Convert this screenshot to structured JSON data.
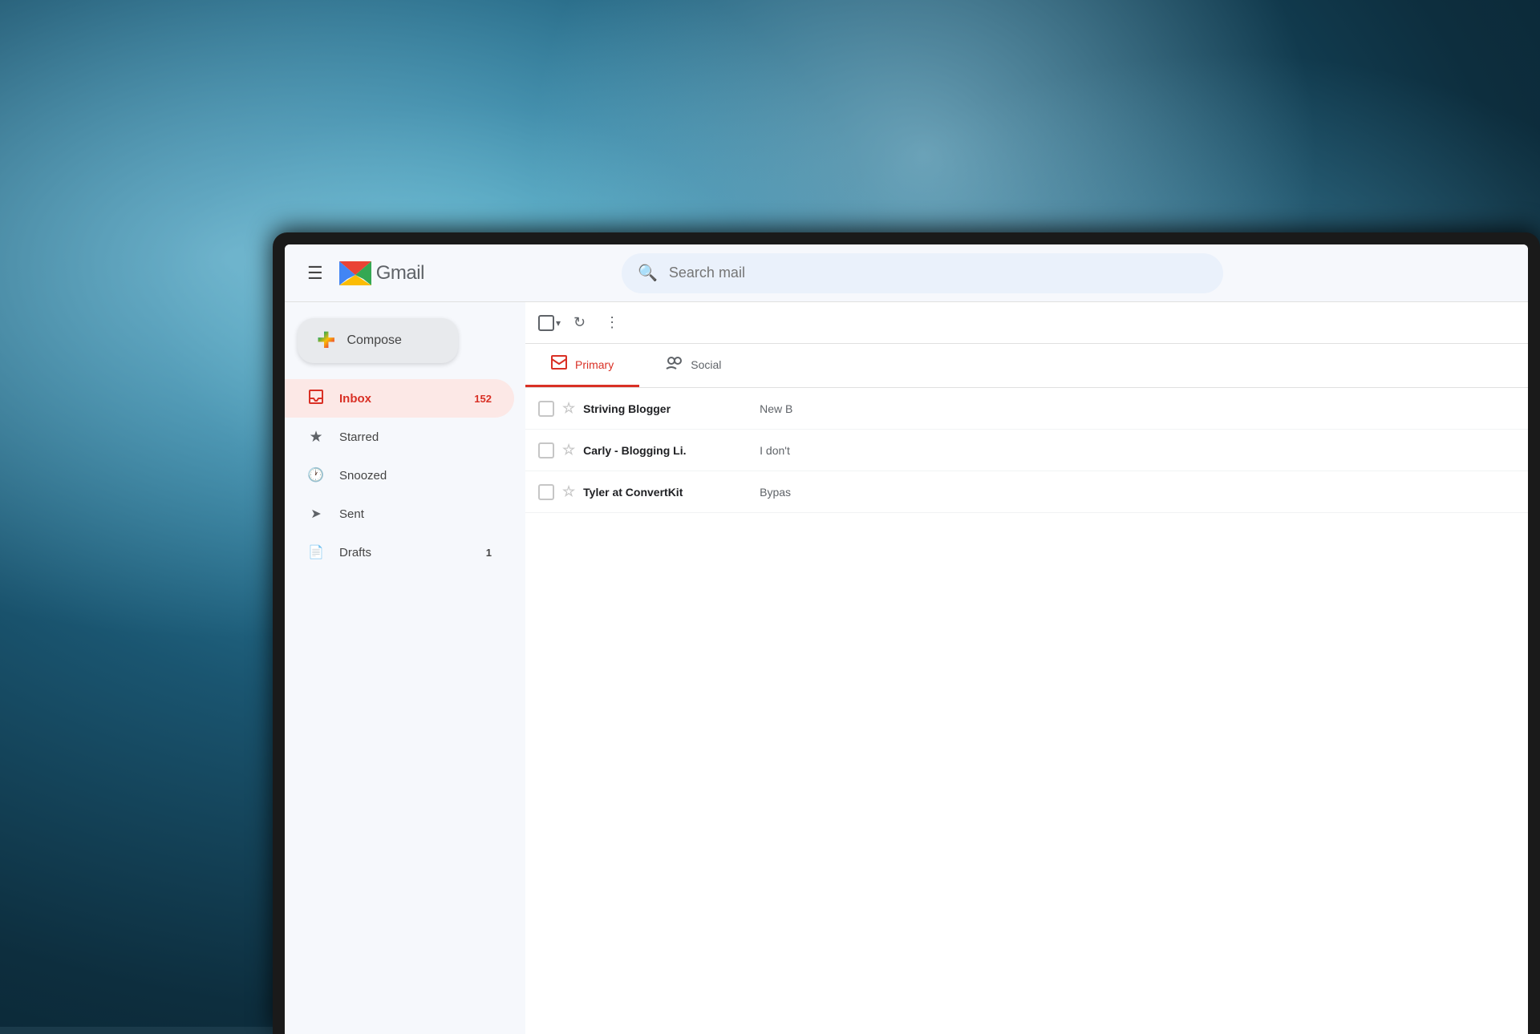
{
  "background": {
    "description": "Blurred teal and blue bokeh background"
  },
  "header": {
    "hamburger_label": "☰",
    "logo_text": "Gmail",
    "search_placeholder": "Search mail"
  },
  "sidebar": {
    "compose_label": "Compose",
    "items": [
      {
        "id": "inbox",
        "label": "Inbox",
        "badge": "152",
        "active": true,
        "icon": "inbox"
      },
      {
        "id": "starred",
        "label": "Starred",
        "badge": "",
        "active": false,
        "icon": "star"
      },
      {
        "id": "snoozed",
        "label": "Snoozed",
        "badge": "",
        "active": false,
        "icon": "clock"
      },
      {
        "id": "sent",
        "label": "Sent",
        "badge": "",
        "active": false,
        "icon": "send"
      },
      {
        "id": "drafts",
        "label": "Drafts",
        "badge": "1",
        "active": false,
        "icon": "draft"
      }
    ]
  },
  "toolbar": {
    "refresh_title": "Refresh",
    "more_title": "More"
  },
  "tabs": [
    {
      "id": "primary",
      "label": "Primary",
      "active": true,
      "icon": "💬"
    },
    {
      "id": "social",
      "label": "Social",
      "active": false,
      "icon": "👥"
    }
  ],
  "emails": [
    {
      "sender": "Striving Blogger",
      "snippet": "New B",
      "starred": false,
      "id": "email-1"
    },
    {
      "sender": "Carly - Blogging Li.",
      "snippet": "I don't",
      "starred": false,
      "id": "email-2"
    },
    {
      "sender": "Tyler at ConvertKit",
      "snippet": "Bypas",
      "starred": false,
      "id": "email-3"
    }
  ]
}
